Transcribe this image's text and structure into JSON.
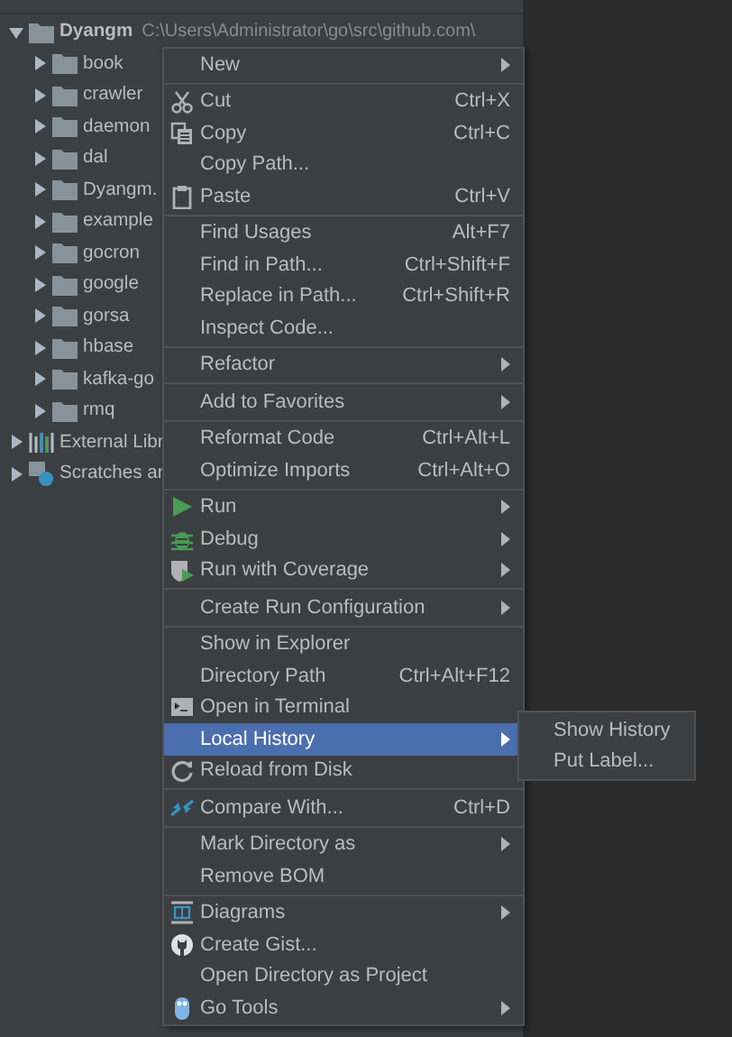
{
  "tree": [
    {
      "label": "Dyangm",
      "path": "C:\\Users\\Administrator\\go\\src\\github.com\\",
      "kind": "folder",
      "expanded": true,
      "children": [
        {
          "label": "book",
          "kind": "folder",
          "expanded": false
        },
        {
          "label": "crawler",
          "kind": "folder",
          "expanded": false
        },
        {
          "label": "daemon",
          "kind": "folder",
          "expanded": false
        },
        {
          "label": "dal",
          "kind": "folder",
          "expanded": false
        },
        {
          "label": "Dyangm.",
          "kind": "folder",
          "expanded": false
        },
        {
          "label": "example",
          "kind": "folder",
          "expanded": false
        },
        {
          "label": "gocron",
          "kind": "folder",
          "expanded": false
        },
        {
          "label": "google",
          "kind": "folder",
          "expanded": false
        },
        {
          "label": "gorsa",
          "kind": "folder",
          "expanded": false
        },
        {
          "label": "hbase",
          "kind": "folder",
          "expanded": false
        },
        {
          "label": "kafka-go",
          "kind": "folder",
          "expanded": false
        },
        {
          "label": "rmq",
          "kind": "folder",
          "expanded": false
        }
      ]
    },
    {
      "label": "External Libr",
      "kind": "library",
      "expanded": false
    },
    {
      "label": "Scratches ar",
      "kind": "scratches",
      "expanded": false
    }
  ],
  "context_menu": [
    [
      {
        "label": "New",
        "submenu": true,
        "selected": false
      }
    ],
    [
      {
        "label": "Cut",
        "shortcut": "Ctrl+X",
        "submenu": false,
        "selected": false
      },
      {
        "label": "Copy",
        "shortcut": "Ctrl+C",
        "submenu": false,
        "selected": false
      },
      {
        "label": "Copy Path...",
        "submenu": false,
        "selected": false
      },
      {
        "label": "Paste",
        "shortcut": "Ctrl+V",
        "submenu": false,
        "selected": false
      }
    ],
    [
      {
        "label": "Find Usages",
        "shortcut": "Alt+F7",
        "submenu": false,
        "selected": false
      },
      {
        "label": "Find in Path...",
        "shortcut": "Ctrl+Shift+F",
        "submenu": false,
        "selected": false
      },
      {
        "label": "Replace in Path...",
        "shortcut": "Ctrl+Shift+R",
        "submenu": false,
        "selected": false
      },
      {
        "label": "Inspect Code...",
        "submenu": false,
        "selected": false
      }
    ],
    [
      {
        "label": "Refactor",
        "submenu": true,
        "selected": false
      }
    ],
    [
      {
        "label": "Add to Favorites",
        "submenu": true,
        "selected": false
      }
    ],
    [
      {
        "label": "Reformat Code",
        "shortcut": "Ctrl+Alt+L",
        "submenu": false,
        "selected": false
      },
      {
        "label": "Optimize Imports",
        "shortcut": "Ctrl+Alt+O",
        "submenu": false,
        "selected": false
      }
    ],
    [
      {
        "label": "Run",
        "submenu": true,
        "selected": false
      },
      {
        "label": "Debug",
        "submenu": true,
        "selected": false
      },
      {
        "label": "Run with Coverage",
        "submenu": true,
        "selected": false
      }
    ],
    [
      {
        "label": "Create Run Configuration",
        "submenu": true,
        "selected": false
      }
    ],
    [
      {
        "label": "Show in Explorer",
        "submenu": false,
        "selected": false
      },
      {
        "label": "Directory Path",
        "shortcut": "Ctrl+Alt+F12",
        "submenu": false,
        "selected": false
      },
      {
        "label": "Open in Terminal",
        "submenu": false,
        "selected": false
      },
      {
        "label": "Local History",
        "submenu": true,
        "selected": true
      },
      {
        "label": "Reload from Disk",
        "submenu": false,
        "selected": false
      }
    ],
    [
      {
        "label": "Compare With...",
        "shortcut": "Ctrl+D",
        "submenu": false,
        "selected": false
      }
    ],
    [
      {
        "label": "Mark Directory as",
        "submenu": true,
        "selected": false
      },
      {
        "label": "Remove BOM",
        "submenu": false,
        "selected": false
      }
    ],
    [
      {
        "label": "Diagrams",
        "submenu": true,
        "selected": false
      },
      {
        "label": "Create Gist...",
        "submenu": false,
        "selected": false
      },
      {
        "label": "Open Directory as Project",
        "submenu": false,
        "selected": false
      },
      {
        "label": "Go Tools",
        "submenu": true,
        "selected": false
      }
    ]
  ],
  "submenu": [
    {
      "label": "Show History"
    },
    {
      "label": "Put Label..."
    }
  ]
}
